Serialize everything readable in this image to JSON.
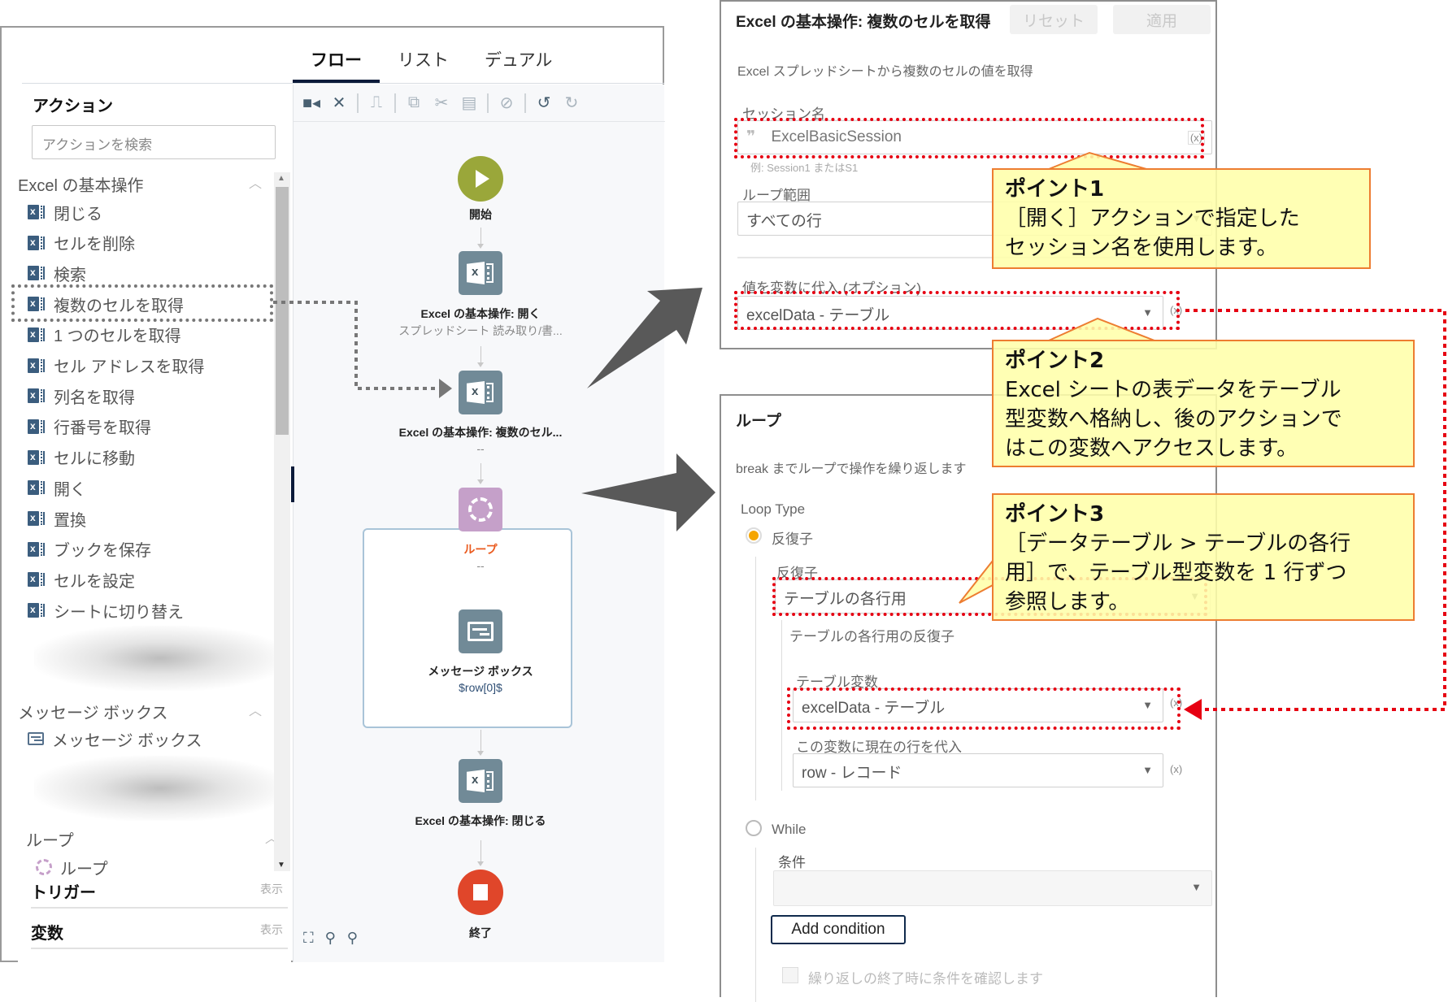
{
  "app": {
    "tabs": [
      {
        "label": "フロー",
        "active": true
      },
      {
        "label": "リスト",
        "active": false
      },
      {
        "label": "デュアル",
        "active": false
      }
    ],
    "toolbar": {
      "icons": [
        "record-icon",
        "recorder-settings-icon",
        "highlight-icon",
        "copy-icon",
        "cut-icon",
        "paste-icon",
        "disable-icon",
        "undo-icon",
        "redo-icon"
      ]
    },
    "sidebar": {
      "title": "アクション",
      "search_placeholder": "アクションを検索",
      "groups": [
        {
          "name": "Excel の基本操作",
          "items": [
            "閉じる",
            "セルを削除",
            "検索",
            "複数のセルを取得",
            "1 つのセルを取得",
            "セル アドレスを取得",
            "列名を取得",
            "行番号を取得",
            "セルに移動",
            "開く",
            "置換",
            "ブックを保存",
            "セルを設定",
            "シートに切り替え"
          ]
        },
        {
          "name": "メッセージ ボックス",
          "items": [
            "メッセージ ボックス"
          ]
        },
        {
          "name": "ループ",
          "items": [
            "ループ"
          ]
        }
      ],
      "triggers_label": "トリガー",
      "variables_label": "変数",
      "show_label": "表示"
    },
    "flow": {
      "start_label": "開始",
      "nodes": [
        {
          "title": "Excel の基本操作: 開く",
          "subtitle": "スプレッドシート 読み取り/書..."
        },
        {
          "title": "Excel の基本操作: 複数のセル...",
          "subtitle": "--"
        },
        {
          "title": "ループ",
          "subtitle": "--"
        },
        {
          "title": "メッセージ ボックス",
          "subtitle": "$row[0]$"
        },
        {
          "title": "Excel の基本操作: 閉じる",
          "subtitle": ""
        }
      ],
      "end_label": "終了",
      "colors": {
        "start": "#9aa73a",
        "end": "#e0462a",
        "action": "#718a97",
        "loop": "#c5a0c9",
        "loop_title": "#ea5a1e"
      }
    }
  },
  "panel_get_cells": {
    "title": "Excel の基本操作: 複数のセルを取得",
    "reset_label": "リセット",
    "apply_label": "適用",
    "description": "Excel スプレッドシートから複数のセルの値を取得",
    "session_label": "セッション名",
    "session_value": "ExcelBasicSession",
    "session_hint": "例: Session1 またはS1",
    "range_label": "ループ範囲",
    "range_value": "すべての行",
    "assign_label": "値を変数に代入 (オプション)",
    "assign_value": "excelData - テーブル",
    "var_button": "(x)"
  },
  "panel_loop": {
    "title": "ループ",
    "description": "break までループで操作を繰り返します",
    "loop_type_label": "Loop Type",
    "option_iterator": "反復子",
    "iterator_label": "反復子",
    "iterator_value": "テーブルの各行用",
    "iterator_sub": "テーブルの各行用の反復子",
    "table_var_label": "テーブル変数",
    "table_var_value": "excelData - テーブル",
    "row_var_label": "この変数に現在の行を代入",
    "row_var_value": "row - レコード",
    "option_while": "While",
    "condition_label": "条件",
    "condition_value": "",
    "add_condition": "Add condition",
    "check_at_end": "繰り返しの終了時に条件を確認します",
    "var_button": "(x)"
  },
  "callouts": [
    {
      "title": "ポイント1",
      "lines": [
        "［開く］アクションで指定した",
        "セッション名を使用します。"
      ]
    },
    {
      "title": "ポイント2",
      "lines": [
        "Excel シートの表データをテーブル",
        "型変数へ格納し、後のアクションで",
        "はこの変数へアクセスします。"
      ]
    },
    {
      "title": "ポイント3",
      "lines": [
        "［データテーブル > テーブルの各行",
        "用］で、テーブル型変数を 1 行ずつ",
        "参照します。"
      ]
    }
  ],
  "annotation_colors": {
    "highlight": "#e60012",
    "callout_border": "#ed7d31",
    "callout_fill": "#ffffaa",
    "pointer_arrow": "#595959"
  }
}
